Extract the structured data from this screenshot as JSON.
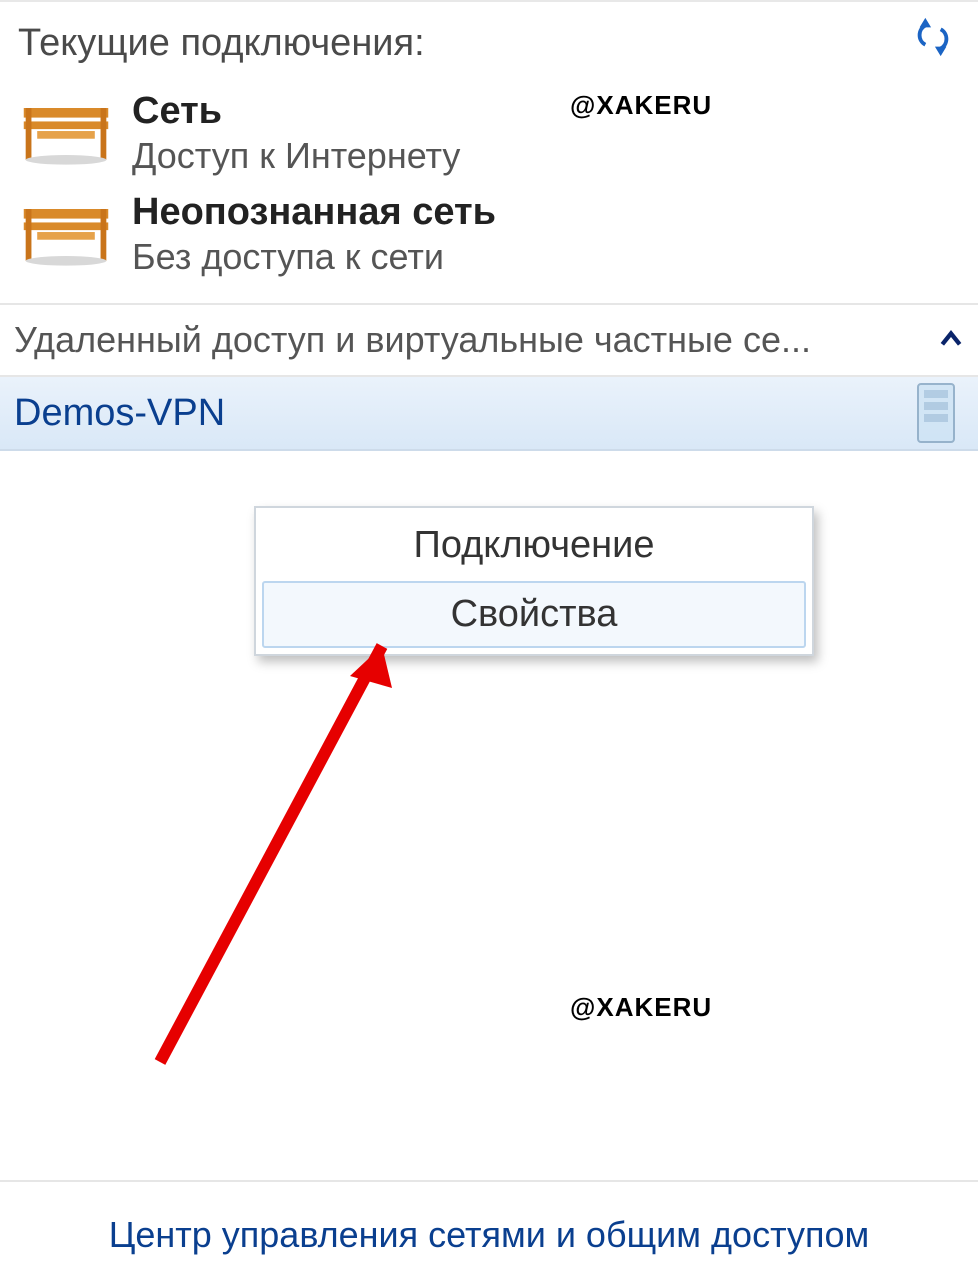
{
  "watermark": "@XAKERU",
  "heading": "Текущие подключения:",
  "networks": [
    {
      "title": "Сеть",
      "sub": "Доступ к Интернету"
    },
    {
      "title": "Неопознанная сеть",
      "sub": "Без доступа к сети"
    }
  ],
  "section_header": "Удаленный доступ и виртуальные частные се...",
  "vpn_name": "Demos-VPN",
  "context_menu": {
    "connect": "Подключение",
    "properties": "Свойства"
  },
  "footer_link": "Центр управления сетями и общим доступом"
}
